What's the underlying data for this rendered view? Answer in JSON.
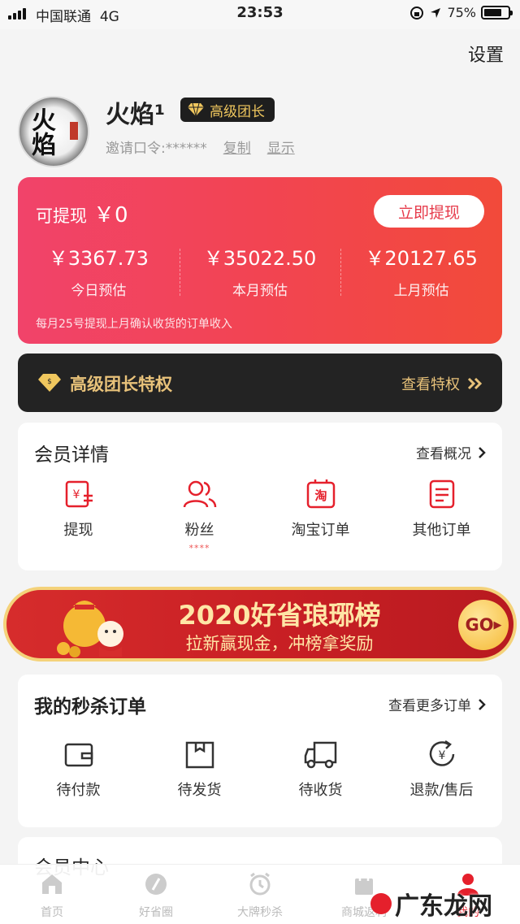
{
  "status_bar": {
    "carrier": "中国联通",
    "network": "4G",
    "time": "23:53",
    "battery": "75%",
    "battery_level": 0.75
  },
  "header": {
    "settings_label": "设置"
  },
  "profile": {
    "nickname": "火焰¹",
    "level_badge": "高级团长",
    "invite_label": "邀请口令:******",
    "copy_label": "复制",
    "show_label": "显示",
    "avatar_text": "火焰"
  },
  "earnings": {
    "available_label": "可提现",
    "available_amount": "￥0",
    "withdraw_button": "立即提现",
    "stats": [
      {
        "value": "￥3367.73",
        "label": "今日预估"
      },
      {
        "value": "￥35022.50",
        "label": "本月预估"
      },
      {
        "value": "￥20127.65",
        "label": "上月预估"
      }
    ],
    "note": "每月25号提现上月确认收货的订单收入"
  },
  "privilege": {
    "title": "高级团长特权",
    "more_label": "查看特权"
  },
  "member": {
    "title": "会员详情",
    "more_label": "查看概况",
    "items": [
      {
        "label": "提现",
        "icon": "withdraw-icon"
      },
      {
        "label": "粉丝",
        "icon": "fans-icon",
        "sub": "****"
      },
      {
        "label": "淘宝订单",
        "icon": "taobao-icon"
      },
      {
        "label": "其他订单",
        "icon": "other-orders-icon"
      }
    ]
  },
  "banner": {
    "title": "2020好省琅琊榜",
    "subtitle": "拉新赢现金，冲榜拿奖励",
    "go_label": "GO"
  },
  "flash_orders": {
    "title": "我的秒杀订单",
    "more_label": "查看更多订单",
    "items": [
      {
        "label": "待付款",
        "icon": "wallet-icon"
      },
      {
        "label": "待发货",
        "icon": "box-icon"
      },
      {
        "label": "待收货",
        "icon": "truck-icon"
      },
      {
        "label": "退款/售后",
        "icon": "refund-icon"
      }
    ]
  },
  "member_center": {
    "title": "会员中心"
  },
  "tabbar": {
    "tabs": [
      {
        "label": "首页",
        "icon": "home-icon"
      },
      {
        "label": "好省圈",
        "icon": "circle-icon"
      },
      {
        "label": "大牌秒杀",
        "icon": "alarm-icon"
      },
      {
        "label": "商城返利",
        "icon": "bag-icon"
      },
      {
        "label": "我的",
        "icon": "user-icon",
        "active": true
      }
    ]
  },
  "watermark": {
    "text": "广东龙网"
  },
  "colors": {
    "accent": "#e5202c",
    "card_gradient_start": "#f1436a",
    "card_gradient_end": "#f24a3a",
    "gold": "#e8c27a",
    "privilege_bg": "#232323"
  }
}
